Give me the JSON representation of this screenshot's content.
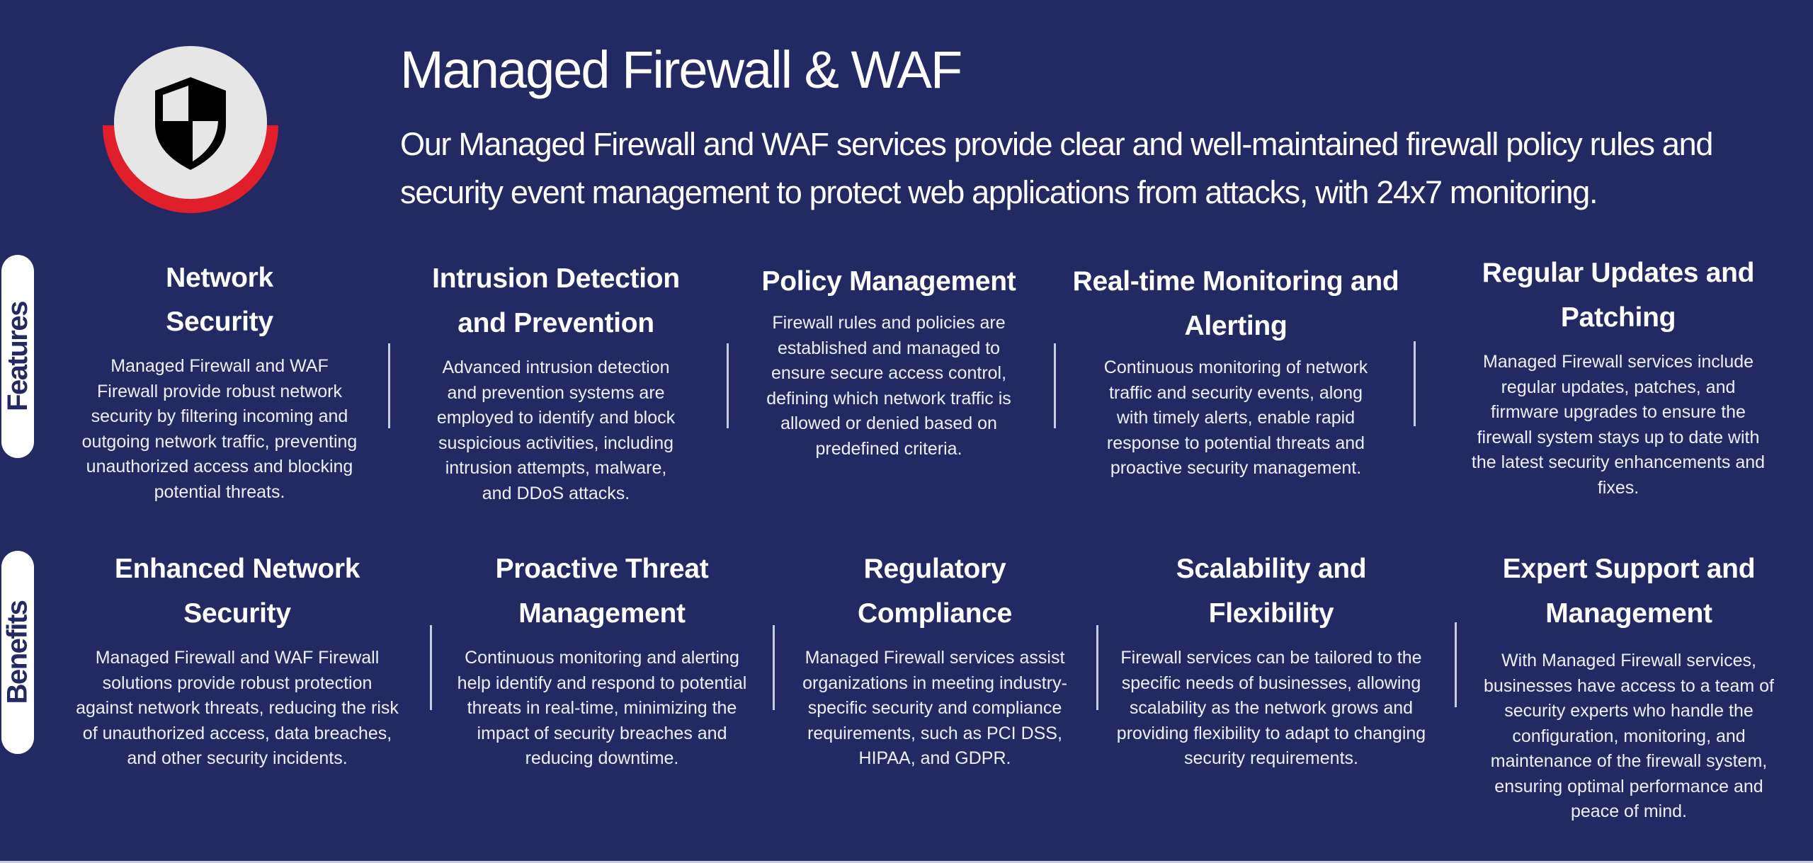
{
  "header": {
    "title": "Managed Firewall & WAF",
    "subtitle": "Our Managed Firewall and WAF services provide clear and well-maintained firewall policy rules and security event management to protect web applications from attacks, with 24x7 monitoring.",
    "logo_icon": "shield-icon"
  },
  "colors": {
    "background": "#232a63",
    "accent_red": "#e01f2b",
    "circle": "#e6e6e6",
    "tab_background": "#ffffff"
  },
  "features": {
    "label": "Features",
    "items": [
      {
        "title": "Network Security",
        "description": "Managed Firewall and WAF Firewall provide robust network security by filtering incoming and outgoing network traffic, preventing unauthorized access and blocking potential threats."
      },
      {
        "title": "Intrusion Detection and Prevention",
        "description": "Advanced intrusion detection and prevention systems are employed to identify and block suspicious activities, including intrusion attempts, malware, and DDoS attacks."
      },
      {
        "title": "Policy Management",
        "description": "Firewall rules and policies are established and managed to ensure secure access control, defining which network traffic is allowed or denied based on predefined criteria."
      },
      {
        "title": "Real-time Monitoring and Alerting",
        "description": "Continuous monitoring of network traffic and security events, along with timely alerts, enable rapid response to potential threats and proactive security management."
      },
      {
        "title": "Regular Updates and Patching",
        "description": "Managed Firewall services include regular updates, patches, and firmware upgrades to ensure the firewall system stays up to date with the latest security enhancements and fixes."
      }
    ]
  },
  "benefits": {
    "label": "Benefits",
    "items": [
      {
        "title": "Enhanced Network Security",
        "description": "Managed Firewall and WAF Firewall solutions provide robust protection against network threats, reducing the risk of unauthorized access, data breaches, and other security incidents."
      },
      {
        "title": "Proactive Threat Management",
        "description": "Continuous monitoring and alerting help identify and respond to potential threats in real-time, minimizing the impact of security breaches and reducing downtime."
      },
      {
        "title": "Regulatory Compliance",
        "description": "Managed Firewall services assist organizations in meeting industry-specific security and compliance requirements, such as PCI DSS, HIPAA, and GDPR."
      },
      {
        "title": "Scalability and Flexibility",
        "description": "Firewall services can be tailored to the specific needs of businesses, allowing scalability as the network grows and providing flexibility to adapt to changing security requirements."
      },
      {
        "title": "Expert Support and Management",
        "description": "With Managed Firewall services, businesses have access to a team of security experts who handle the configuration, monitoring, and maintenance of the firewall system, ensuring optimal performance and peace of mind."
      }
    ]
  }
}
